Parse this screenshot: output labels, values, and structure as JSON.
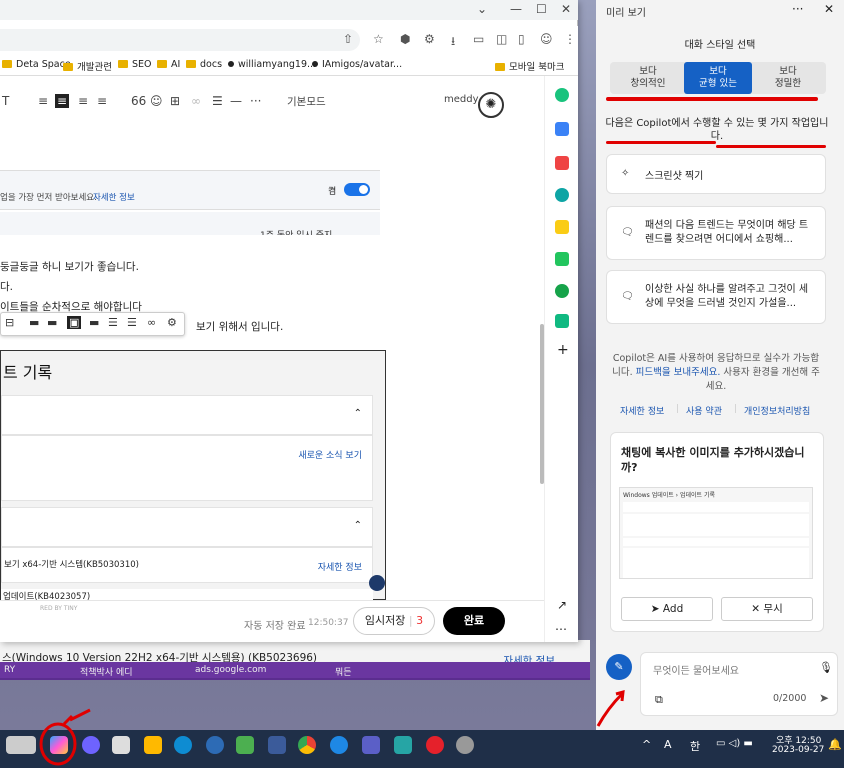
{
  "browser": {
    "title_controls": {
      "dropdown": "⌄",
      "minimize": "—",
      "maximize": "☐",
      "close": "✕"
    },
    "bookmarks": [
      {
        "label": "Deta Space",
        "type": "folder"
      },
      {
        "label": "개발관련",
        "type": "folder"
      },
      {
        "label": "SEO",
        "type": "folder"
      },
      {
        "label": "AI",
        "type": "folder"
      },
      {
        "label": "docs",
        "type": "folder"
      },
      {
        "label": "williamyang19...",
        "type": "page"
      },
      {
        "label": "IAmigos/avatar...",
        "type": "page"
      }
    ],
    "mobile_bookmarks": "모바일 북마크"
  },
  "editor": {
    "mode": "기본모드",
    "user": "meddy",
    "notice_text": "업을 가장 먼저 받아보세요.",
    "notice_link": "자세한 정보",
    "toggle_label": "켬",
    "pause_label": "1주 동안 일시 중지",
    "lines": [
      "둥글둥글 하니 보기가 좋습니다.",
      "다.",
      "이트들을 순차적으로 해야합니다",
      "보기 위해서 입니다."
    ],
    "image": {
      "title": "트 기록",
      "news_link": "새로운 소식 보기",
      "update1": "보기 x64-기반 시스템(KB5030310)",
      "update1_link": "자세한 정보",
      "update2": "업데이트(KB4023057)",
      "powered": "RED BY TINY"
    },
    "autosave": "자동 저장 완료",
    "autosave_time": "12:50:37",
    "temp_save": "임시저장",
    "temp_count": "3",
    "done": "완료"
  },
  "background_window": {
    "text": "스(Windows 10 Version 22H2 x64-기반 시스템용) (KB5023696)",
    "link": "자세한 정보",
    "strip": [
      "RY",
      "적책박사 에디",
      "ads.google.com",
      "뭐든"
    ]
  },
  "copilot": {
    "header": "미리 보기",
    "menu_icon": "···",
    "close_icon": "✕",
    "style_title": "대화 스타일 선택",
    "styles": [
      {
        "line1": "보다",
        "line2": "창의적인",
        "active": false
      },
      {
        "line1": "보다",
        "line2": "균형 있는",
        "active": true
      },
      {
        "line1": "보다",
        "line2": "정밀한",
        "active": false
      }
    ],
    "intro": "다음은 Copilot에서 수행할 수 있는 몇 가지 작업입니다.",
    "suggestions": [
      "스크린샷 찍기",
      "패션의 다음 트렌드는 무엇이며 해당 트렌드를 찾으려면 어디에서 쇼핑해...",
      "이상한 사실 하나를 알려주고 그것이 세상에 무엇을 드러낼 것인지 가설을..."
    ],
    "disclaimer_pre": "Copilot은 AI를 사용하여 응답하므로 실수가 가능합니다.",
    "disclaimer_link": "피드백을 보내주세요.",
    "disclaimer_post": "사용자 환경을 개선해 주세요.",
    "links": [
      "자세한 정보",
      "사용 약관",
      "개인정보처리방침"
    ],
    "paste_title": "채팅에 복사한 이미지를 추가하시겠습니까?",
    "thumb_header": "Windows 업데이트 › 업데이트 기록",
    "add_label": "Add",
    "ignore_label": "무시",
    "input_placeholder": "무엇이든 물어보세요",
    "char_count": "0/2000"
  },
  "taskbar": {
    "time": "오후 12:50",
    "date": "2023-09-27",
    "tray": [
      "^",
      "A",
      "한"
    ]
  },
  "colors": {
    "accent": "#1561c5",
    "annotation_red": "#e00000",
    "taskbar": "#1f2f48",
    "toggle": "#1a73e8"
  }
}
